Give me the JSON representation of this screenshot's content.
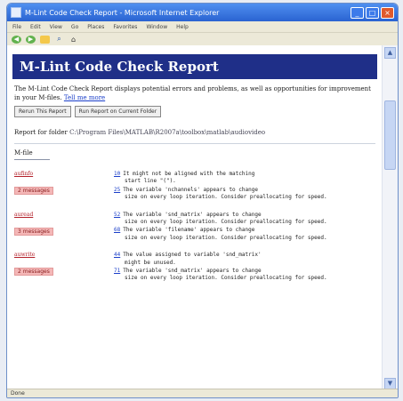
{
  "window": {
    "title": "M-Lint Code Check Report - Microsoft Internet Explorer"
  },
  "menubar": {
    "items": [
      "File",
      "Edit",
      "View",
      "Go",
      "Places",
      "Favorites",
      "Window",
      "Help"
    ]
  },
  "toolbar": {
    "icons": [
      "back-icon",
      "forward-icon",
      "folder-icon",
      "search-icon",
      "home-icon"
    ]
  },
  "report": {
    "title": "M-Lint Code Check Report",
    "intro_text": "The M-Lint Code Check Report displays potential errors and problems, as well as opportunities for improvement in your M-files.",
    "intro_link": "Tell me more",
    "btn_rerun": "Rerun This Report",
    "btn_run_current": "Run Report on Current Folder",
    "report_for_label": "Report for folder",
    "report_for_path": "C:\\Program Files\\MATLAB\\R2007a\\toolbox\\matlab\\audiovideo",
    "column_header": "M-file",
    "entries": [
      {
        "name": "aufinfo",
        "count": "2 messages",
        "messages": [
          {
            "line": "10",
            "text": "It might not be aligned with the matching",
            "cont": "start line \"(\")."
          },
          {
            "line": "25",
            "text": "The variable 'nchannels' appears to change",
            "cont": "size on every loop iteration. Consider preallocating for speed."
          }
        ]
      },
      {
        "name": "auread",
        "count": "3 messages",
        "messages": [
          {
            "line": "52",
            "text": "The variable 'snd_matrix' appears to change",
            "cont": "size on every loop iteration. Consider preallocating for speed."
          },
          {
            "line": "68",
            "text": "The variable 'filename' appears to change",
            "cont": "size on every loop iteration. Consider preallocating for speed."
          }
        ]
      },
      {
        "name": "auwrite",
        "count": "2 messages",
        "messages": [
          {
            "line": "44",
            "text": "The value assigned to variable 'snd_matrix'",
            "cont": "might be unused."
          },
          {
            "line": "71",
            "text": "The variable 'snd_matrix' appears to change",
            "cont": "size on every loop iteration. Consider preallocating for speed."
          }
        ]
      }
    ]
  },
  "status": {
    "text": "Done"
  }
}
